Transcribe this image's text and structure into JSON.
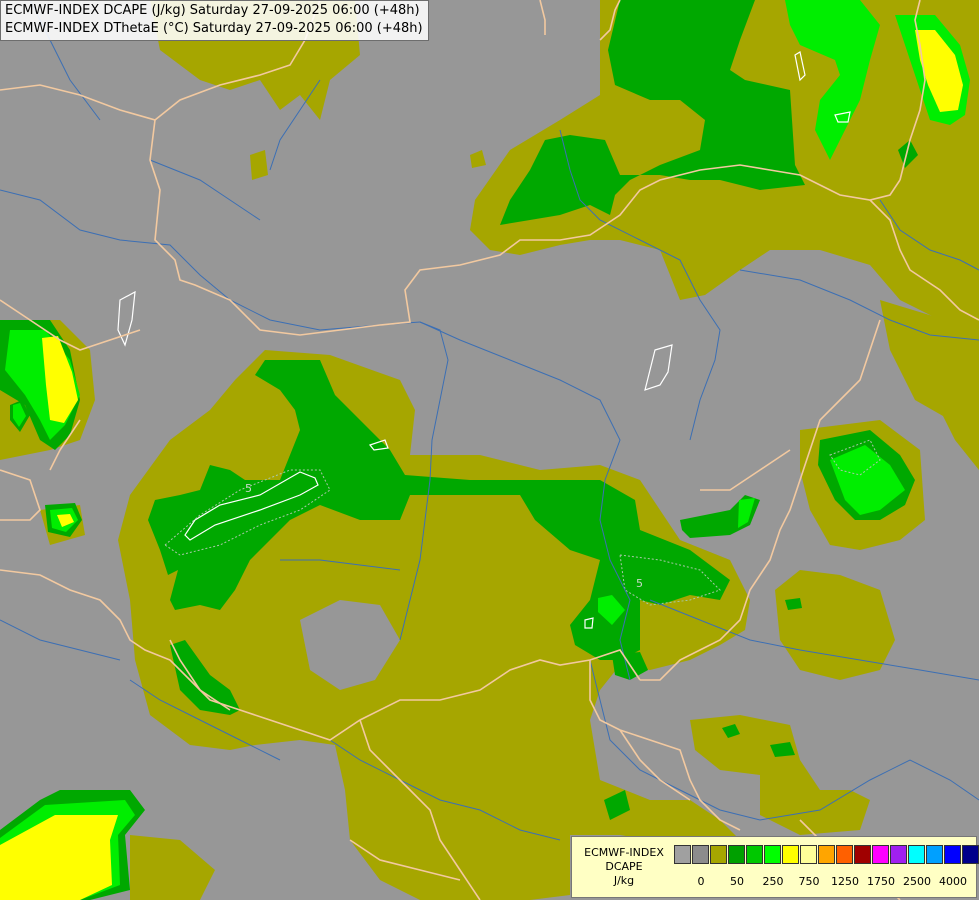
{
  "titles": {
    "line1": "ECMWF-INDEX DCAPE (J/kg) Saturday 27-09-2025 06:00 (+48h)",
    "line2": "ECMWF-INDEX DThetaE (°C) Saturday 27-09-2025 06:00 (+48h)"
  },
  "contour_labels": [
    "5",
    "5"
  ],
  "legend": {
    "line1": "ECMWF-INDEX",
    "line2": "DCAPE",
    "unit": "J/kg",
    "colors": [
      "#a0a0a0",
      "#8c8c8c",
      "#a6a600",
      "#00a000",
      "#00c800",
      "#00ff00",
      "#ffff00",
      "#ffff99",
      "#ffa500",
      "#ff6000",
      "#a00000",
      "#ff00ff",
      "#a020f0",
      "#00ffff",
      "#00a0ff",
      "#0000ff",
      "#00008b"
    ],
    "ticks": [
      "0",
      "50",
      "250",
      "750",
      "1250",
      "1750",
      "2500",
      "4000"
    ]
  },
  "colors": {
    "background": "#979797",
    "olive": "#a6a600",
    "green": "#00a800",
    "bright_green": "#00e600",
    "yellow": "#ffff00",
    "border": "#f2c9a0",
    "river": "#3c6fb4"
  }
}
